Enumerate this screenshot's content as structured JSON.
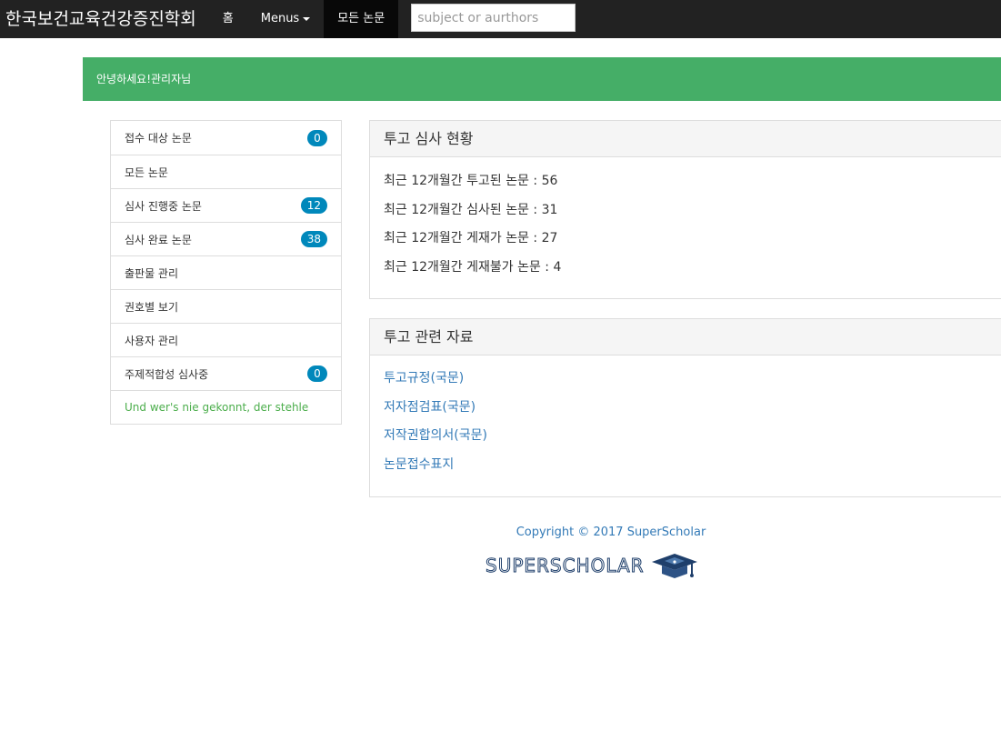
{
  "navbar": {
    "brand": "한국보건교육건강증진학회",
    "home": "홈",
    "menus": "Menus",
    "all_papers": "모든 논문",
    "search_placeholder": "subject or aurthors"
  },
  "alert": {
    "greeting": "안녕하세요!관리자님"
  },
  "sidebar": {
    "items": [
      {
        "label": "접수 대상 논문",
        "badge": "0"
      },
      {
        "label": "모든 논문",
        "badge": null
      },
      {
        "label": "심사 진행중 논문",
        "badge": "12"
      },
      {
        "label": "심사 완료 논문",
        "badge": "38"
      },
      {
        "label": "출판물 관리",
        "badge": null
      },
      {
        "label": "권호별 보기",
        "badge": null
      },
      {
        "label": "사용자 관리",
        "badge": null
      },
      {
        "label": "주제적합성 심사중",
        "badge": "0"
      }
    ],
    "quote": "Und wer's nie gekonnt, der stehle"
  },
  "review_panel": {
    "title": "투고 심사 현황",
    "lines": [
      "최근 12개월간 투고된 논문 : 56",
      "최근 12개월간 심사된 논문 : 31",
      "최근 12개월간 게재가 논문 : 27",
      "최근 12개월간 게재불가 논문 : 4"
    ]
  },
  "resources_panel": {
    "title": "투고 관련 자료",
    "links": [
      "투고규정(국문)",
      "저자점검표(국문)",
      "저작권합의서(국문)",
      "논문접수표지"
    ]
  },
  "footer": {
    "copyright": "Copyright © 2017 SuperScholar",
    "logo_text": "SUPERSCHOLAR",
    "logo_icon": "graduation-cap-icon",
    "logo_color": "#1f3f6b"
  },
  "colors": {
    "navbar": "#222222",
    "alert": "#45ae67",
    "badge": "#0088bb",
    "link": "#337ab7",
    "quote": "#4cae4c"
  }
}
